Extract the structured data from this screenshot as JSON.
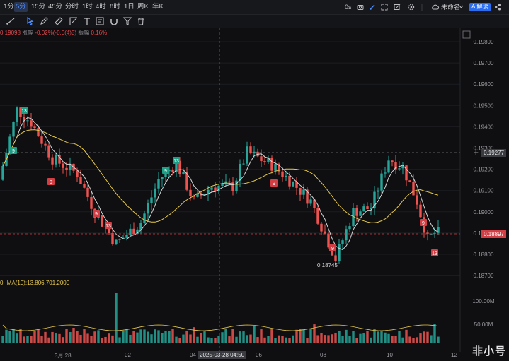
{
  "toolbar": {
    "timeframes": [
      "1分",
      "5分",
      "15分",
      "45分",
      "分时",
      "1时",
      "4时",
      "8时",
      "1日",
      "周K",
      "年K"
    ],
    "active_timeframe": "5分",
    "refresh": "0s",
    "layout_name": "未命名",
    "ai_button": "AI解读"
  },
  "info": {
    "close": "0.19098",
    "change_label": "涨幅",
    "change": "-0.02%(-0.0(4)3)",
    "amplitude_label": "振幅",
    "amplitude": "0.16%"
  },
  "volume": {
    "label_prefix": "0",
    "ma_label": "MA(10):13,806,701.2000"
  },
  "price_axis": [
    "0.19800",
    "0.19700",
    "0.19600",
    "0.19500",
    "0.19400",
    "0.19300",
    "0.19200",
    "0.19100",
    "0.19000",
    "0.18900",
    "0.18800",
    "0.18700"
  ],
  "volume_axis": [
    "100.00M",
    "50.00M"
  ],
  "crosshair": {
    "price": "0.19277",
    "time": "2025-03-28 04:50"
  },
  "current_price": "0.18897",
  "low_label": "0.18745",
  "x_labels": [
    "3月 28",
    "02",
    "04",
    "06",
    "08",
    "10",
    "12"
  ],
  "td_markers": {
    "green": [
      "9",
      "13",
      "9",
      "13"
    ],
    "red": [
      "9",
      "9",
      "13",
      "9",
      "9",
      "9",
      "13"
    ]
  },
  "watermark": "非小号",
  "colors": {
    "up": "#26a69a",
    "down": "#ef5350",
    "accent": "#2b6df0",
    "ma_white": "#d8d8d8",
    "ma_yellow": "#e6c84a"
  }
}
